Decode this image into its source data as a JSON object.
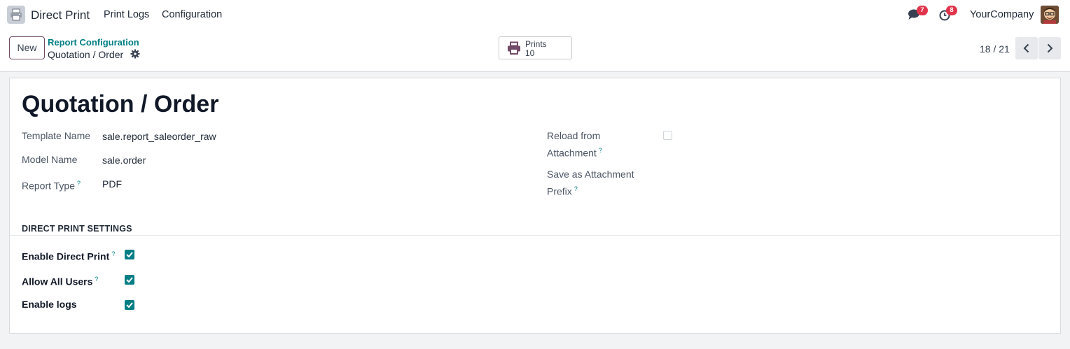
{
  "navbar": {
    "app_name": "Direct Print",
    "menu": [
      "Print Logs",
      "Configuration"
    ],
    "messages_count": "7",
    "activities_count": "8",
    "company": "YourCompany"
  },
  "control_panel": {
    "new_label": "New",
    "breadcrumb_parent": "Report Configuration",
    "breadcrumb_current": "Quotation / Order",
    "stat_button": {
      "label": "Prints",
      "value": "10",
      "icon": "printer-icon"
    },
    "pager": "18 / 21"
  },
  "form": {
    "title": "Quotation / Order",
    "fields_left": [
      {
        "label": "Template Name",
        "value": "sale.report_saleorder_raw",
        "help": ""
      },
      {
        "label": "Model Name",
        "value": "sale.order",
        "help": ""
      },
      {
        "label": "Report Type",
        "value": "PDF",
        "help": "?"
      }
    ],
    "reload_from_attachment": {
      "label_line1": "Reload from",
      "label_line2": "Attachment",
      "help": "?",
      "checked": false
    },
    "save_as_attachment": {
      "label_line1": "Save as Attachment",
      "label_line2": "Prefix",
      "help": "?",
      "value": ""
    },
    "section_title": "DIRECT PRINT SETTINGS",
    "settings": [
      {
        "label": "Enable Direct Print",
        "help": "?",
        "checked": true
      },
      {
        "label": "Allow All Users",
        "help": "?",
        "checked": true
      },
      {
        "label": "Enable logs",
        "help": "",
        "checked": true
      }
    ]
  },
  "colors": {
    "accent": "#017e84",
    "brand": "#714b67",
    "badge": "#e0344b"
  }
}
